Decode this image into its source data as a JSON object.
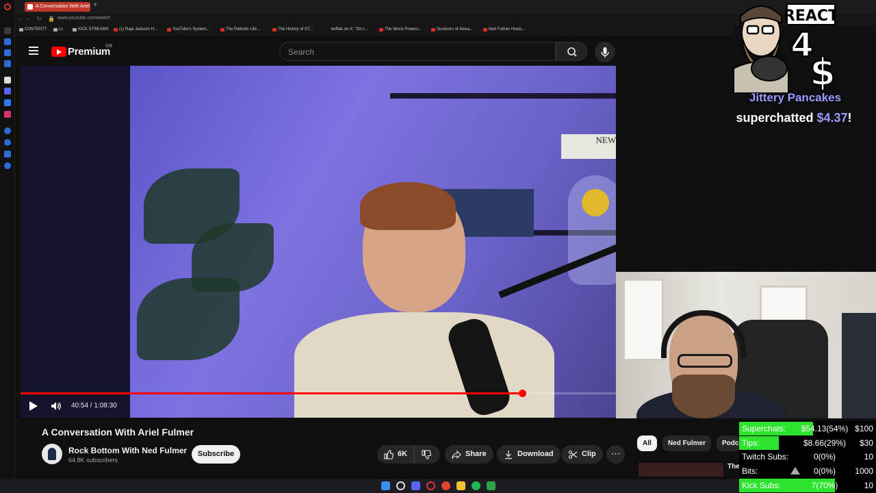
{
  "browser": {
    "tab_title": "A Conversation With Ariel",
    "url": "www.youtube.com/watch",
    "bookmarks": [
      {
        "label": "CONTENT?",
        "type": "folder"
      },
      {
        "label": "LL",
        "type": "folder"
      },
      {
        "label": "KICK STREAMS",
        "type": "folder"
      },
      {
        "label": "(1) Raja Jackson H...",
        "type": "youtube"
      },
      {
        "label": "YouTube's System...",
        "type": "youtube"
      },
      {
        "label": "The Pathetic Life...",
        "type": "youtube"
      },
      {
        "label": "The History of GT...",
        "type": "youtube"
      },
      {
        "label": "keffals on X: \"On t...",
        "type": "x"
      },
      {
        "label": "The Worst Powers...",
        "type": "youtube"
      },
      {
        "label": "Survivors of Alexa...",
        "type": "youtube"
      },
      {
        "label": "Ned Fulmer Hosts...",
        "type": "youtube"
      }
    ]
  },
  "youtube": {
    "brand": "Premium",
    "country": "GB",
    "search_placeholder": "Search",
    "video": {
      "time": "40:54 / 1:08:30",
      "progress": 0.842,
      "scene_text": "NEW YORK"
    },
    "title": "A Conversation With Ariel Fulmer",
    "channel": {
      "name": "Rock Bottom With Ned Fulmer",
      "subscribers": "64.8K subscribers",
      "subscribe_label": "Subscribe"
    },
    "actions": {
      "likes": "6K",
      "share": "Share",
      "download": "Download",
      "clip": "Clip"
    },
    "chips": [
      "All",
      "Ned Fulmer",
      "Podc"
    ],
    "related": {
      "title": "The"
    }
  },
  "alert": {
    "art_text_top": "REACT",
    "art_text_num": "4",
    "art_text_sym": "$",
    "donor": "Jittery Pancakes",
    "message_prefix": "superchatted ",
    "amount": "$4.37",
    "message_suffix": "!"
  },
  "stats": [
    {
      "label": "Superchats:",
      "value": "$54.13(54%)",
      "goal": "$100",
      "fill": 0.54
    },
    {
      "label": "Tips:",
      "value": "$8.66(29%)",
      "goal": "$30",
      "fill": 0.29
    },
    {
      "label": "Twitch Subs:",
      "value": "0(0%)",
      "goal": "10",
      "fill": 0
    },
    {
      "label": "Bits:",
      "value": "0(0%)",
      "goal": "1000",
      "fill": 0
    },
    {
      "label": "Kick Subs:",
      "value": "7(70%)",
      "goal": "10",
      "fill": 0.7
    }
  ],
  "colors": {
    "yt_red": "#ff0000",
    "goal_green": "#2ee32e",
    "alert_purple": "#9c9bff"
  }
}
